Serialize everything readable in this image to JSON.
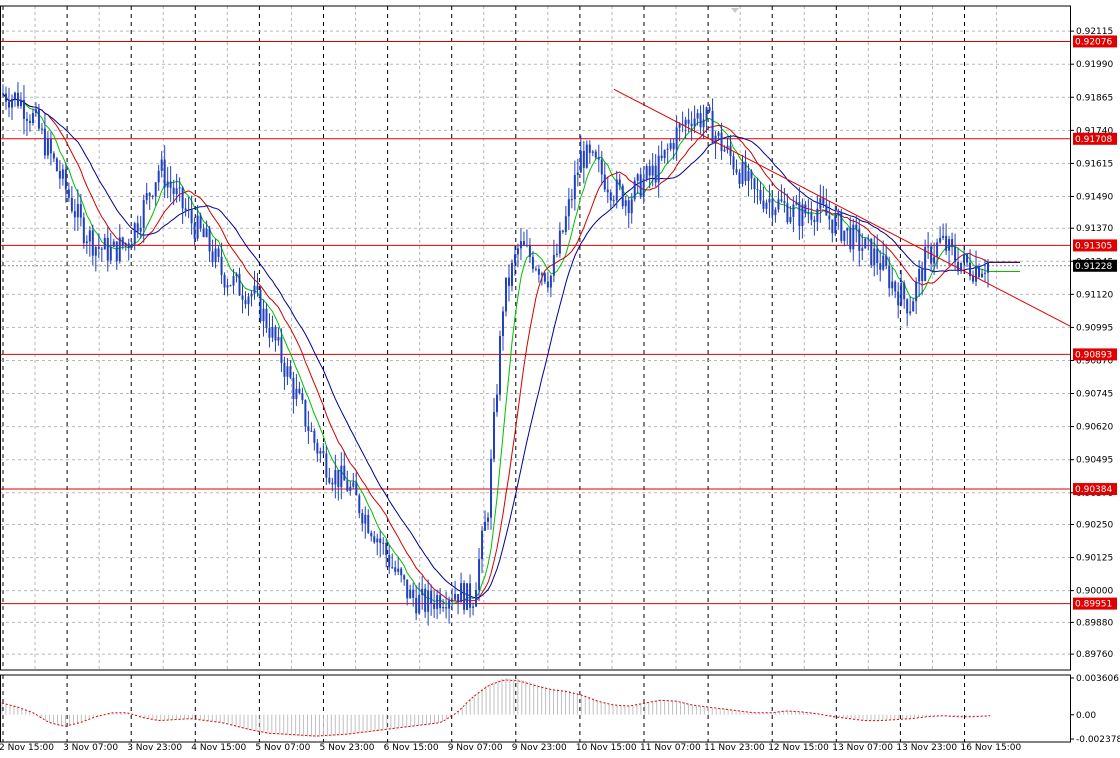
{
  "chart_data": {
    "type": "candlestick",
    "price_ticks": [
      "0.92115",
      "0.91990",
      "0.91865",
      "0.91740",
      "0.91615",
      "0.91490",
      "0.91370",
      "0.91245",
      "0.91120",
      "0.90995",
      "0.90870",
      "0.90745",
      "0.90620",
      "0.90495",
      "0.90370",
      "0.90250",
      "0.90125",
      "0.90000",
      "0.89880",
      "0.89760"
    ],
    "time_labels": [
      "2 Nov 15:00",
      "3 Nov 07:00",
      "3 Nov 23:00",
      "4 Nov 15:00",
      "5 Nov 07:00",
      "5 Nov 23:00",
      "6 Nov 15:00",
      "9 Nov 07:00",
      "9 Nov 23:00",
      "10 Nov 15:00",
      "11 Nov 07:00",
      "11 Nov 23:00",
      "12 Nov 15:00",
      "13 Nov 07:00",
      "13 Nov 23:00",
      "16 Nov 15:00"
    ],
    "current_price": "0.91228",
    "horizontal_levels": [
      {
        "label": "0.92076",
        "value": 0.92076
      },
      {
        "label": "0.91708",
        "value": 0.91708
      },
      {
        "label": "0.91305",
        "value": 0.91305
      },
      {
        "label": "0.90893",
        "value": 0.90893
      },
      {
        "label": "0.90384",
        "value": 0.90384
      },
      {
        "label": "0.89951",
        "value": 0.89951
      }
    ],
    "trendline": {
      "from": [
        0.0,
        0.91895
      ],
      "to": [
        1.0,
        0.91
      ],
      "x_range": "11 Nov 07:00 to right edge"
    },
    "price_path": [
      0.9188,
      0.9186,
      0.9178,
      0.9165,
      0.9152,
      0.9138,
      0.913,
      0.9128,
      0.9132,
      0.9145,
      0.916,
      0.915,
      0.914,
      0.9132,
      0.912,
      0.9115,
      0.9112,
      0.91,
      0.9085,
      0.907,
      0.9055,
      0.9045,
      0.904,
      0.903,
      0.902,
      0.9008,
      0.8998,
      0.8995,
      0.8998,
      0.9,
      0.8996,
      0.903,
      0.911,
      0.913,
      0.9125,
      0.9118,
      0.914,
      0.9165,
      0.916,
      0.9152,
      0.9148,
      0.9155,
      0.916,
      0.9172,
      0.918,
      0.9178,
      0.9168,
      0.916,
      0.915,
      0.9148,
      0.9145,
      0.9142,
      0.9145,
      0.914,
      0.9135,
      0.913,
      0.9125,
      0.9115,
      0.9108,
      0.9125,
      0.9132,
      0.9125,
      0.9122,
      0.9124
    ],
    "oscillator": {
      "ticks": [
        "0.003606",
        "0.00",
        "-0.002378"
      ],
      "range": [
        -0.002378,
        0.003606
      ],
      "values": [
        0.0012,
        0.0008,
        0.0002,
        -0.0008,
        -0.0012,
        -0.0008,
        -0.0002,
        0.0002,
        0.0002,
        -0.0003,
        -0.0006,
        -0.0005,
        -0.0004,
        -0.0006,
        -0.0008,
        -0.0012,
        -0.0016,
        -0.0019,
        -0.002,
        -0.0021,
        -0.0022,
        -0.0021,
        -0.002,
        -0.0018,
        -0.0016,
        -0.0014,
        -0.0012,
        -0.001,
        -0.0008,
        0.0002,
        0.0018,
        0.003,
        0.0036,
        0.0035,
        0.003,
        0.0026,
        0.0024,
        0.002,
        0.0014,
        0.001,
        0.0009,
        0.0012,
        0.0015,
        0.0014,
        0.001,
        0.0008,
        0.0006,
        0.0004,
        0.0002,
        0.0002,
        0.0004,
        0.0003,
        0.0001,
        -0.0002,
        -0.0004,
        -0.0006,
        -0.0006,
        -0.0005,
        -0.0004,
        -0.0002,
        -0.0001,
        -0.0002,
        -0.0002,
        -0.0001
      ]
    },
    "colors": {
      "candles": "#2040c0",
      "levels": "#e00000",
      "ma_fast": "#00c000",
      "ma_mid": "#d00000",
      "ma_slow": "#000090",
      "grid": "#b8b8b8",
      "osc_pos": "#c0c0c0",
      "osc_line": "#e00000"
    }
  }
}
